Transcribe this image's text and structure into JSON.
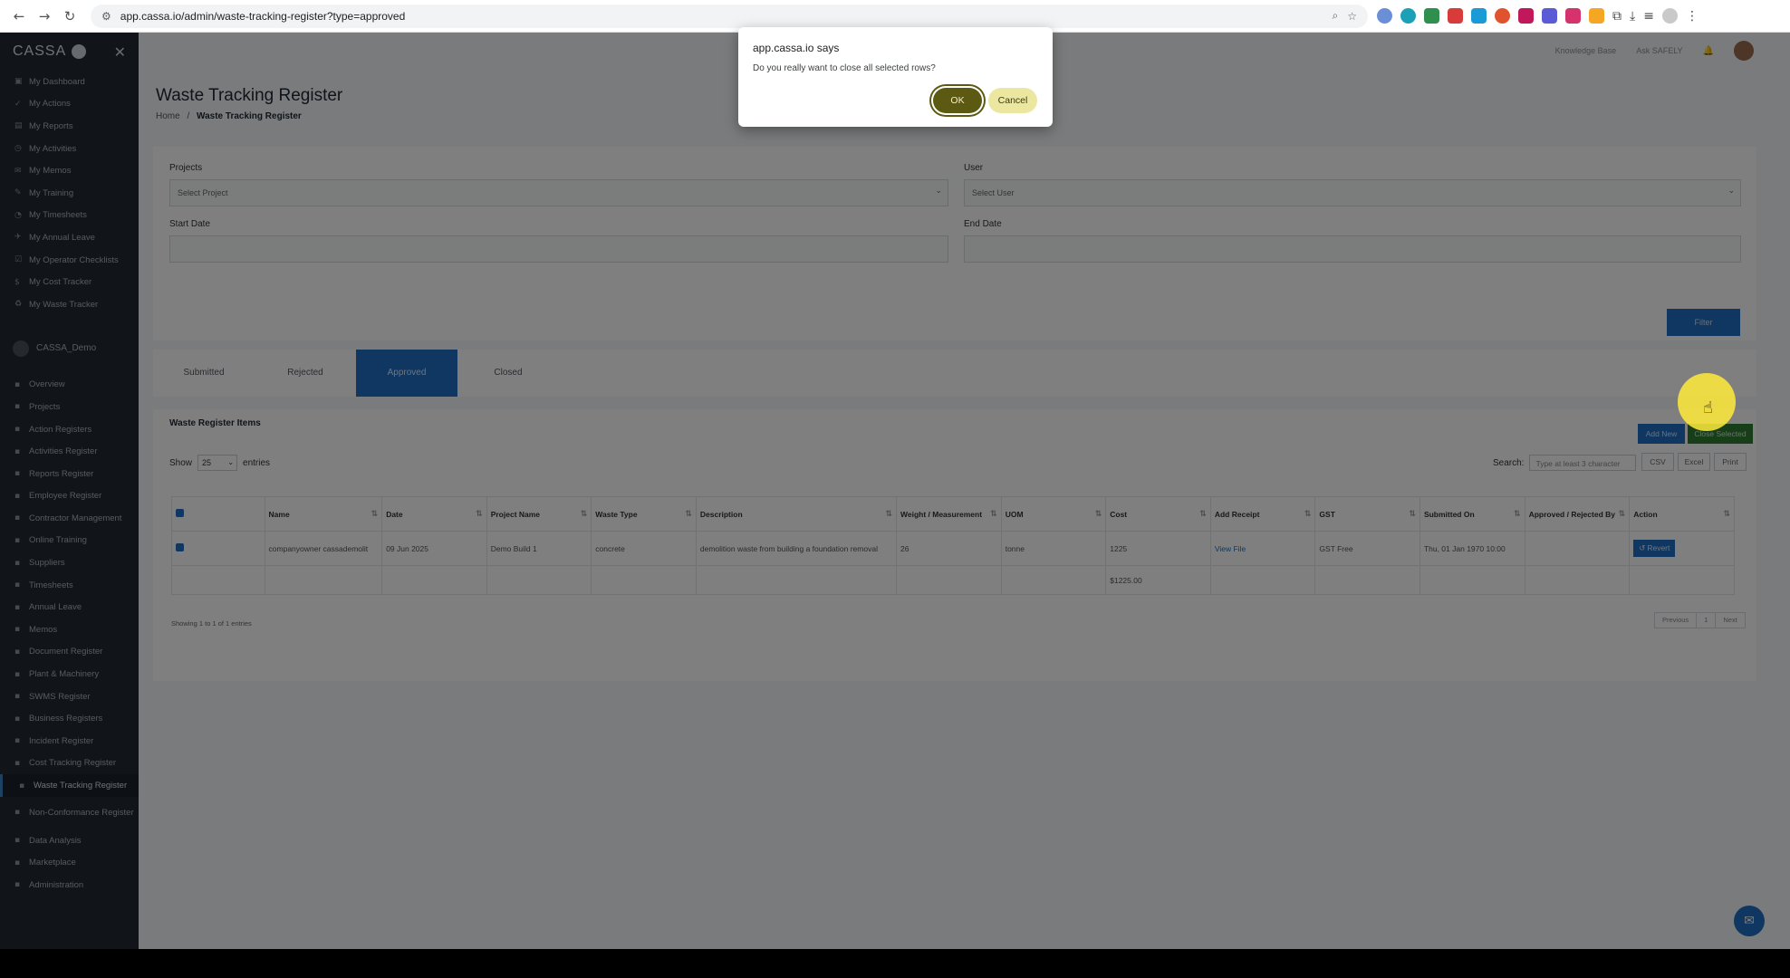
{
  "browser": {
    "url": "app.cassa.io/admin/waste-tracking-register?type=approved"
  },
  "sidebar": {
    "logo": "CASSA",
    "personal": [
      "My Dashboard",
      "My Actions",
      "My Reports",
      "My Activities",
      "My Memos",
      "My Training",
      "My Timesheets",
      "My Annual Leave",
      "My Operator Checklists",
      "My Cost Tracker",
      "My Waste Tracker"
    ],
    "org_name": "CASSA_Demo",
    "org_items": [
      "Overview",
      "Projects",
      "Action Registers",
      "Activities Register",
      "Reports Register",
      "Employee Register",
      "Contractor Management",
      "Online Training",
      "Suppliers",
      "Timesheets",
      "Annual Leave",
      "Memos",
      "Document Register",
      "Plant & Machinery",
      "SWMS Register",
      "Business Registers",
      "Incident Register",
      "Cost Tracking Register",
      "Waste Tracking Register"
    ],
    "org_items_after": [
      "Data Analysis",
      "Marketplace",
      "Administration"
    ],
    "tall_item": "Non-Conformance Register"
  },
  "topbar": {
    "kb": "Knowledge Base",
    "ask": "Ask SAFELY"
  },
  "page": {
    "title": "Waste Tracking Register",
    "breadcrumb_home": "Home",
    "breadcrumb_sep": "/",
    "breadcrumb_current": "Waste Tracking Register"
  },
  "filters": {
    "projects_label": "Projects",
    "projects_placeholder": "Select Project",
    "user_label": "User",
    "user_placeholder": "Select User",
    "start_label": "Start Date",
    "end_label": "End Date",
    "filter_button": "Filter"
  },
  "tabs": [
    "Submitted",
    "Rejected",
    "Approved",
    "Closed"
  ],
  "table": {
    "title": "Waste Register Items",
    "add_new": "Add New",
    "close_selected": "Close Selected",
    "show_label": "Show",
    "show_value": "25",
    "entries_label": "entries",
    "search_label": "Search:",
    "search_placeholder": "Type at least 3 character",
    "csv": "CSV",
    "excel": "Excel",
    "print": "Print",
    "headers": [
      "Name",
      "Date",
      "Project Name",
      "Waste Type",
      "Description",
      "Weight / Measurement",
      "UOM",
      "Cost",
      "Add Receipt",
      "GST",
      "Submitted On",
      "Approved / Rejected By",
      "Action"
    ],
    "row": {
      "name": "companyowner cassademolit",
      "date": "09 Jun 2025",
      "project": "Demo Build 1",
      "waste_type": "concrete",
      "description": "demolition waste from building a foundation removal",
      "weight": "26",
      "uom": "tonne",
      "cost": "1225",
      "receipt": "View File",
      "gst": "GST Free",
      "submitted_on": "Thu, 01 Jan 1970 10:00",
      "approved_by": "",
      "action": "Revert"
    },
    "total": "$1225.00",
    "showing": "Showing 1 to 1 of 1 entries",
    "pager": [
      "Previous",
      "1",
      "Next"
    ]
  },
  "dialog": {
    "title": "app.cassa.io says",
    "message": "Do you really want to close all selected rows?",
    "ok": "OK",
    "cancel": "Cancel"
  }
}
